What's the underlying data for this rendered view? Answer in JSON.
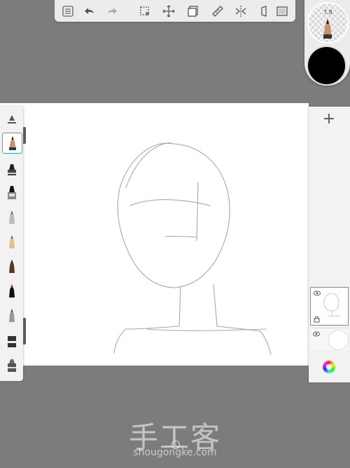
{
  "toolbar": {
    "buttons": [
      "list-icon",
      "undo-icon",
      "redo-icon",
      "select-icon",
      "transform-icon",
      "layers-icon",
      "ruler-icon",
      "symmetry-icon",
      "perspective-icon",
      "fullscreen-icon"
    ]
  },
  "brush_puck": {
    "size_label": "7.8"
  },
  "color_puck": {
    "color": "#000000"
  },
  "brushes": [
    "ruler-brush-icon",
    "pencil-brush-icon",
    "marker-brush-icon",
    "paint-brush-icon",
    "airbrush-icon",
    "pen-brush-icon",
    "fountain-pen-icon",
    "ink-pen-icon",
    "smudge-icon",
    "eraser-icon",
    "fill-icon"
  ],
  "layers": {
    "add_label": "+"
  },
  "watermark": {
    "logo": "手工客",
    "url": "shougongke.com"
  }
}
